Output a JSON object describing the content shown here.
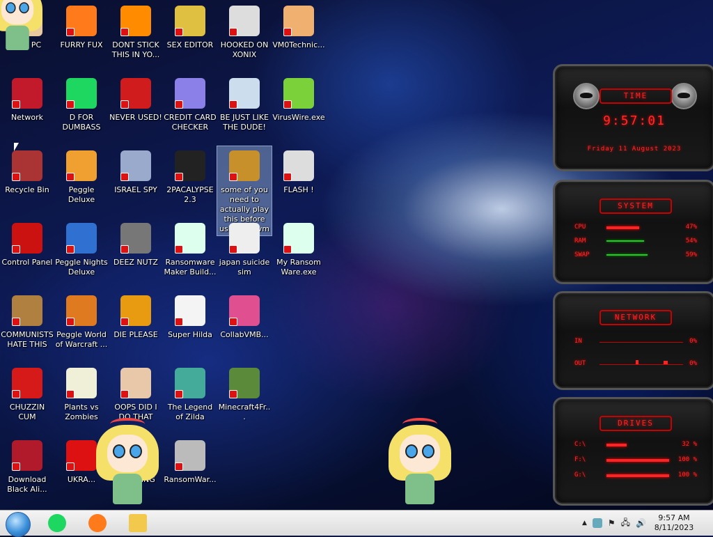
{
  "desktop": {
    "icons": [
      {
        "label": "This PC",
        "icon": "this-pc-icon",
        "color": "#e8c9a0"
      },
      {
        "label": "FURRY FUX",
        "icon": "firefox-icon",
        "color": "#ff7a1a"
      },
      {
        "label": "DONT STICK THIS IN YO...",
        "icon": "vlc-icon",
        "color": "#ff8c00"
      },
      {
        "label": "SEX EDITOR",
        "icon": "hxd-icon",
        "color": "#e0c040"
      },
      {
        "label": "HOOKED ON XONIX",
        "icon": "xonix-icon",
        "color": "#ddd"
      },
      {
        "label": "VM0Technic...",
        "icon": "technician-icon",
        "color": "#f0b070"
      },
      {
        "label": "Network",
        "icon": "network-icon",
        "color": "#c21a2a"
      },
      {
        "label": "D FOR DUMBASS",
        "icon": "discord-icon",
        "color": "#1ed760"
      },
      {
        "label": "NEVER USED!",
        "icon": "devcpp-icon",
        "color": "#d01c1c"
      },
      {
        "label": "CREDIT CARD CHECKER",
        "icon": "credit-card-icon",
        "color": "#8a80e8"
      },
      {
        "label": "BE JUST LIKE THE DUDE!",
        "icon": "elf-icon",
        "color": "#cde"
      },
      {
        "label": "VirusWire.exe",
        "icon": "limewire-icon",
        "color": "#7ad13a"
      },
      {
        "label": "Recycle Bin",
        "icon": "recycle-bin-icon",
        "color": "#a33"
      },
      {
        "label": "Peggle Deluxe",
        "icon": "peggle-icon",
        "color": "#f0a030"
      },
      {
        "label": "ISRAEL SPY",
        "icon": "spy-network-icon",
        "color": "#9ac"
      },
      {
        "label": "2PACALYPSE 2.3",
        "icon": "terminal-icon",
        "color": "#222"
      },
      {
        "label": "some of you need to actually play this before using the vm",
        "icon": "scooby-icon",
        "color": "#c8902a"
      },
      {
        "label": "FLASH !",
        "icon": "flash-icon",
        "color": "#ddd"
      },
      {
        "label": "Control Panel",
        "icon": "control-panel-icon",
        "color": "#c11"
      },
      {
        "label": "Peggle Nights Deluxe",
        "icon": "peggle-nights-icon",
        "color": "#3070d0"
      },
      {
        "label": "DEEZ NUTZ",
        "icon": "stack-windows-icon",
        "color": "#777"
      },
      {
        "label": "Ransomware Maker Build...",
        "icon": "app-window-icon",
        "color": "#dfe"
      },
      {
        "label": "japan suicide sim",
        "icon": "game-sprites-icon",
        "color": "#eee"
      },
      {
        "label": "My Ransom Ware.exe",
        "icon": "app-window-icon",
        "color": "#dfe"
      },
      {
        "label": "COMMUNISTS HATE THIS G...",
        "icon": "money-bag-icon",
        "color": "#b08040"
      },
      {
        "label": "Peggle World of Warcraft ...",
        "icon": "peggle-wow-icon",
        "color": "#e07a20"
      },
      {
        "label": "DIE PLEASE",
        "icon": "de-icon",
        "color": "#e89a10"
      },
      {
        "label": "Super Hilda",
        "icon": "pixel-cat-icon",
        "color": "#f4f4f4"
      },
      {
        "label": "CollabVMB...",
        "icon": "monitor-icon",
        "color": "#e05090"
      },
      {
        "label": "CHUZZIN CUM",
        "icon": "chuzzle-icon",
        "color": "#d61a1a"
      },
      {
        "label": "Plants vs Zombies",
        "icon": "flower-icon",
        "color": "#f0f0d8"
      },
      {
        "label": "OOPS DID I DO THAT",
        "icon": "portrait-icon",
        "color": "#e8c8a8"
      },
      {
        "label": "The Legend of Zilda",
        "icon": "zelda-icon",
        "color": "#4a9"
      },
      {
        "label": "Minecraft4Fr...",
        "icon": "grass-block-icon",
        "color": "#5a8a3a"
      },
      {
        "label": "Download Black Ali...",
        "icon": "alien-icon",
        "color": "#b01a2a"
      },
      {
        "label": "UKRA...",
        "icon": "radiation-icon",
        "color": "#d11"
      },
      {
        "label": "LYNCHING",
        "icon": "noose-icon",
        "color": "#ccc"
      },
      {
        "label": "RansomWar...",
        "icon": "skull-icon",
        "color": "#bbb"
      }
    ],
    "selected_index": 16
  },
  "widget": {
    "time": {
      "title": "TIME",
      "clock": "9:57:01",
      "date": "Friday 11 August 2023"
    },
    "system": {
      "title": "SYSTEM",
      "rows": [
        {
          "label": "CPU",
          "value": "47%",
          "level": 0.47,
          "kind": "red"
        },
        {
          "label": "RAM",
          "value": "54%",
          "level": 0.54,
          "kind": "green"
        },
        {
          "label": "SWAP",
          "value": "59%",
          "level": 0.59,
          "kind": "green"
        }
      ]
    },
    "network": {
      "title": "NETWORK",
      "rows": [
        {
          "label": "IN",
          "value": "0%"
        },
        {
          "label": "OUT",
          "value": "0%"
        }
      ]
    },
    "drives": {
      "title": "DRIVES",
      "rows": [
        {
          "label": "C:\\",
          "value": "32 %",
          "level": 0.32
        },
        {
          "label": "F:\\",
          "value": "100 %",
          "level": 1.0
        },
        {
          "label": "G:\\",
          "value": "100 %",
          "level": 1.0
        }
      ]
    }
  },
  "taskbar": {
    "apps": [
      {
        "name": "spotify-app",
        "icon": "spotify-icon",
        "color": "#1ed760"
      },
      {
        "name": "firefox-app",
        "icon": "firefox-icon",
        "color": "#ff7a1a"
      },
      {
        "name": "explorer-app",
        "icon": "folder-icon",
        "color": "#f2c94c"
      }
    ],
    "tray": {
      "show_hidden": "▲",
      "icons": [
        "app-tray-icon",
        "flag-icon",
        "network-icon",
        "volume-icon"
      ]
    },
    "clock": {
      "time": "9:57 AM",
      "date": "8/11/2023"
    }
  }
}
